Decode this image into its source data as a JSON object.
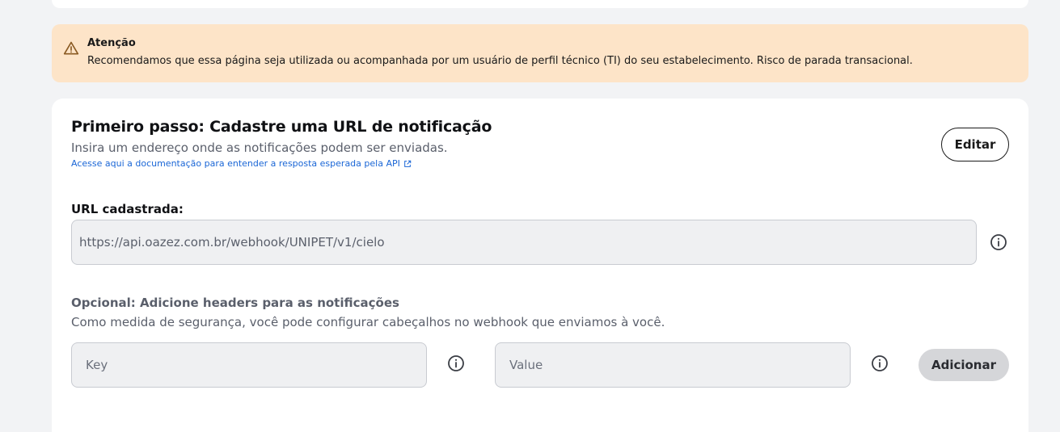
{
  "alert": {
    "title": "Atenção",
    "message": "Recomendamos que essa página seja utilizada ou acompanhada por um usuário de perfil técnico (TI) do seu estabelecimento. Risco de parada transacional.",
    "icon": "warning-triangle-icon",
    "background": "#fde4c8"
  },
  "step": {
    "title": "Primeiro passo: Cadastre uma URL de notificação",
    "subtitle": "Insira um endereço onde as notificações podem ser enviadas.",
    "doc_link": "Acesse aqui a documentação para entender a resposta esperada pela API",
    "edit_label": "Editar"
  },
  "url": {
    "label": "URL cadastrada:",
    "value": "https://api.oazez.com.br/webhook/UNIPET/v1/cielo"
  },
  "headers": {
    "title": "Opcional: Adicione headers para as notificações",
    "subtitle": "Como medida de segurança, você pode configurar cabeçalhos no webhook que enviamos à você.",
    "key_placeholder": "Key",
    "value_placeholder": "Value",
    "add_label": "Adicionar"
  },
  "colors": {
    "link": "#1a66d6",
    "page_background": "#f2f3f5",
    "input_background": "#eff0f2",
    "button_disabled": "#d5d6d9"
  }
}
